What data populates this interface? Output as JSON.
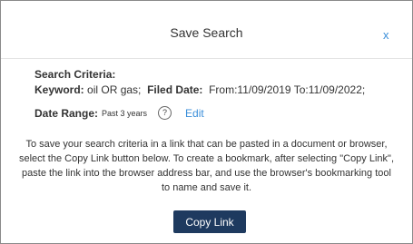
{
  "dialog": {
    "title": "Save Search",
    "close_label": "x"
  },
  "criteria": {
    "heading": "Search Criteria:",
    "keyword_label": "Keyword:",
    "keyword_value": "oil OR gas;",
    "filed_date_label": "Filed Date:",
    "filed_date_value": "From:11/09/2019 To:11/09/2022;",
    "date_range_label": "Date Range:",
    "date_range_value": "Past 3 years",
    "help_icon": "?",
    "edit_label": "Edit"
  },
  "instructions": "To save your search criteria in a link that can be pasted in a document or browser, select the Copy Link button below. To create a bookmark, after selecting \"Copy Link\", paste the link into the browser address bar, and use the browser's bookmarking tool to name and save it.",
  "actions": {
    "copy_link_label": "Copy Link"
  },
  "colors": {
    "link": "#3a8ed9",
    "button_bg": "#1e3a5f"
  }
}
